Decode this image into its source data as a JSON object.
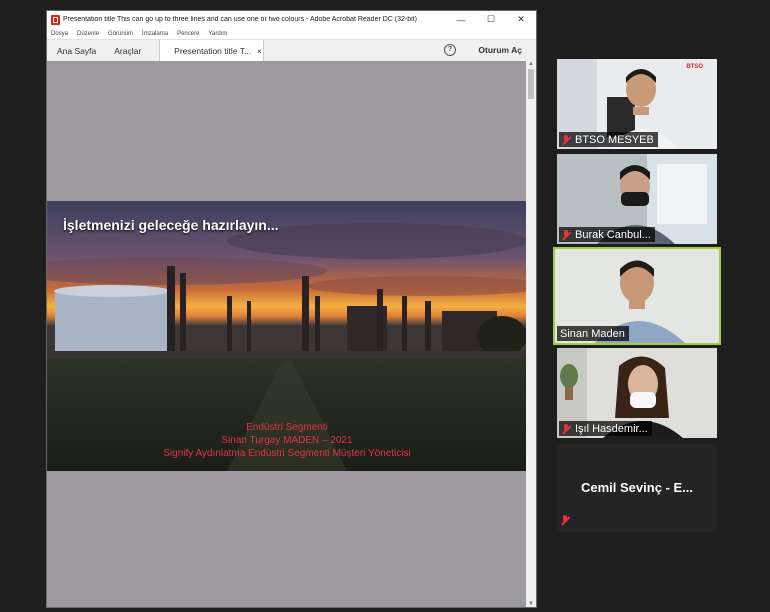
{
  "window": {
    "title": "Presentation title This can go up to three lines and can use one or two colours - Adobe Acrobat Reader DC (32-bit)",
    "minimize": "—",
    "maximize": "☐",
    "close": "✕"
  },
  "menu": [
    "Dosya",
    "Düzenle",
    "Görünüm",
    "İmzalama",
    "Pencere",
    "Yardım"
  ],
  "tabs": {
    "home": "Ana Sayfa",
    "tools": "Araçlar",
    "document": "Presentation title T...",
    "close": "×",
    "help": "?",
    "signin": "Oturum Aç"
  },
  "slide": {
    "heading": "İşletmenizi geleceğe hazırlayın...",
    "line1": "Endüstri Segmenti",
    "line2": "Sinan Turgay MADEN – 2021",
    "line3": "Signify Aydınlatma Endüstri Segmenti Müşteri Yöneticisi",
    "text_color": "#e0344a"
  },
  "participants": [
    {
      "name": "BTSO MESYEB",
      "muted": true,
      "active": false
    },
    {
      "name": "Burak Canbul...",
      "muted": true,
      "active": false
    },
    {
      "name": "Sinan Maden",
      "muted": false,
      "active": true
    },
    {
      "name": "Işıl Hasdemir...",
      "muted": true,
      "active": false
    },
    {
      "name": "Cemil Sevinç - E...",
      "muted": true,
      "active": false,
      "video_off": true
    }
  ],
  "logo_text": "BTSO",
  "colors": {
    "active_speaker_border": "#9ed03a",
    "muted_icon": "#e8323c"
  }
}
